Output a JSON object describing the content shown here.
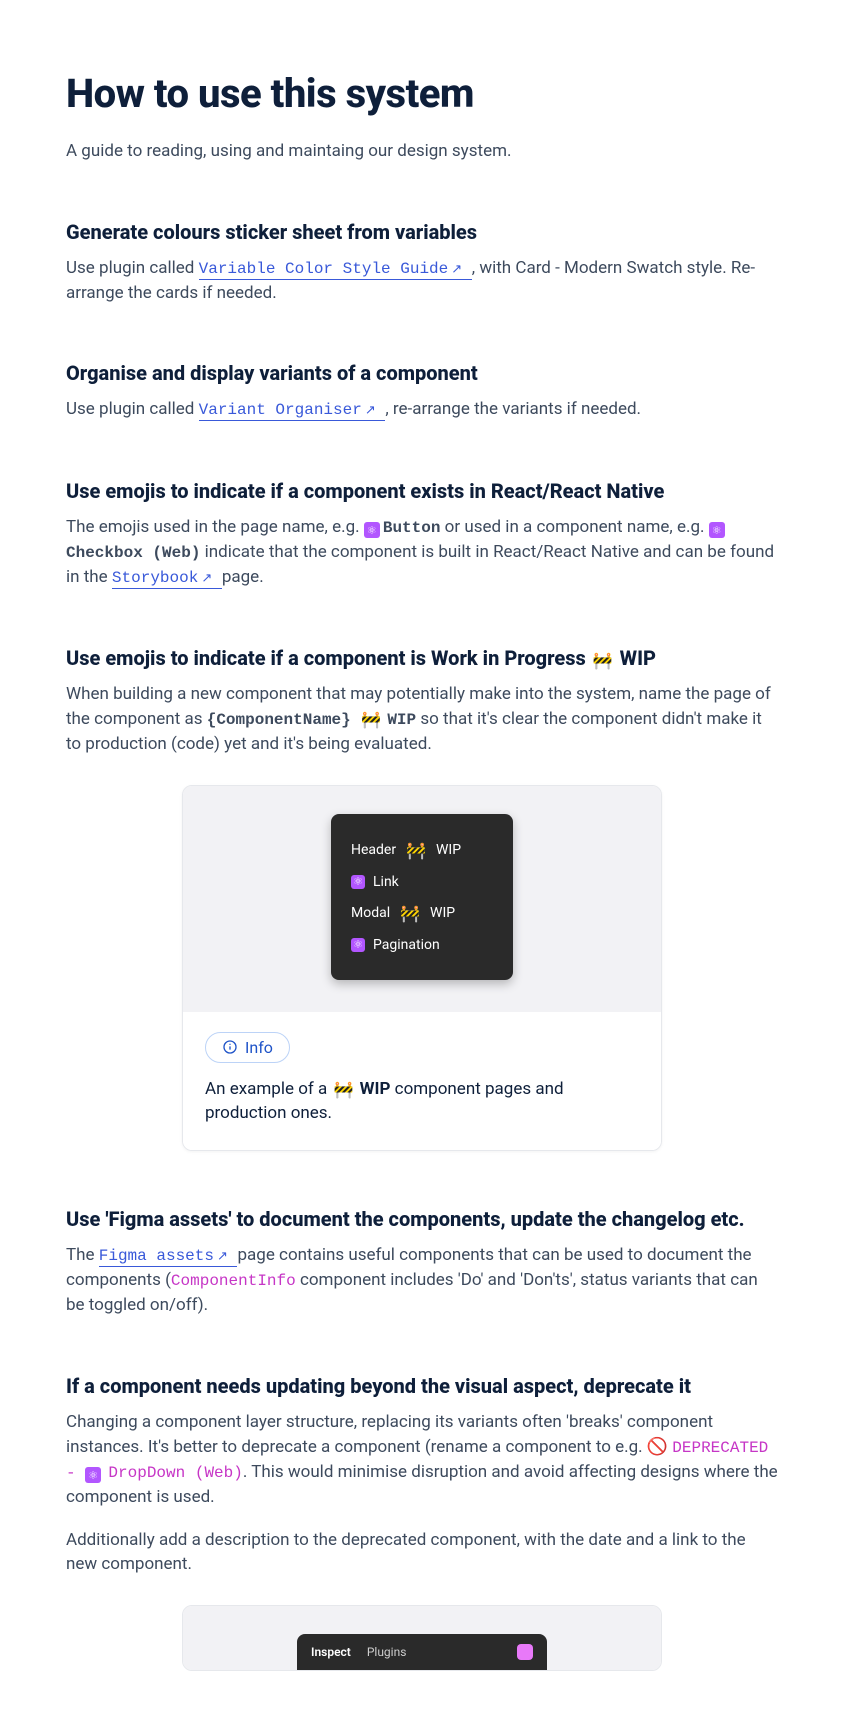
{
  "title": "How to use this system",
  "subtitle": "A guide to reading, using and maintaing our design system.",
  "sections": {
    "colours": {
      "heading": "Generate colours sticker sheet from variables",
      "pre": "Use plugin called ",
      "link": "Variable Color Style Guide",
      "post": ", with Card - Modern Swatch style. Re-arrange the cards if needed."
    },
    "organise": {
      "heading": "Organise and display variants of a component",
      "pre": "Use plugin called ",
      "link": "Variant Organiser",
      "post": ", re-arrange the variants if needed."
    },
    "react": {
      "heading": "Use emojis to indicate if a component exists in React/React Native",
      "pre": "The emojis used in the page name, e.g. ",
      "token1": "Button",
      "mid": " or used in a component name, e.g. ",
      "token2": "Checkbox (Web)",
      "after_token2": " indicate that the component is built in React/React Native and can be found in the ",
      "storybook": "Storybook",
      "tail": " page."
    },
    "wip": {
      "heading_pre": "Use emojis to indicate if a component is Work in Progress ",
      "heading_wip": "WIP",
      "body_pre": "When building a new component that may potentially make into the system, name the page of the component as ",
      "token_name": "{ComponentName}",
      "token_wip": "WIP",
      "body_post": " so that it's clear the component didn't make it to production (code) yet and it's being evaluated."
    },
    "wip_card": {
      "items": [
        {
          "label": "Header",
          "wip": true
        },
        {
          "label": "Link",
          "wip": false,
          "atom": true
        },
        {
          "label": "Modal",
          "wip": true
        },
        {
          "label": "Pagination",
          "wip": false,
          "atom": true
        }
      ],
      "badge": "Info",
      "desc_pre": "An example of a ",
      "desc_wip": "WIP",
      "desc_post": " component pages and production ones."
    },
    "figma": {
      "heading": "Use 'Figma assets' to document the components, update the changelog etc.",
      "pre": "The ",
      "link": "Figma assets",
      "mid": " page contains useful components that can be used to document the components (",
      "token": "ComponentInfo",
      "post": " component includes 'Do' and 'Don'ts', status variants that can be toggled on/off)."
    },
    "deprecate": {
      "heading": "If a component needs updating beyond the visual aspect, deprecate it",
      "p1_pre": "Changing a component layer structure, replacing its variants often 'breaks' component instances. It's better to deprecate a component (rename a component to e.g. ",
      "deprecated_token": "DEPRECATED - ",
      "dropdown_token": "DropDown (Web)",
      "p1_post": ". This would minimise disruption and avoid affecting designs where the component is used.",
      "p2": "Additionally add a description to the deprecated component, with the date and a link to the new component."
    },
    "tabs": {
      "inspect": "Inspect",
      "plugins": "Plugins"
    }
  },
  "glyphs": {
    "ext": "↗",
    "wip": "🚧",
    "no": "🚫",
    "wip_label": "WIP"
  }
}
